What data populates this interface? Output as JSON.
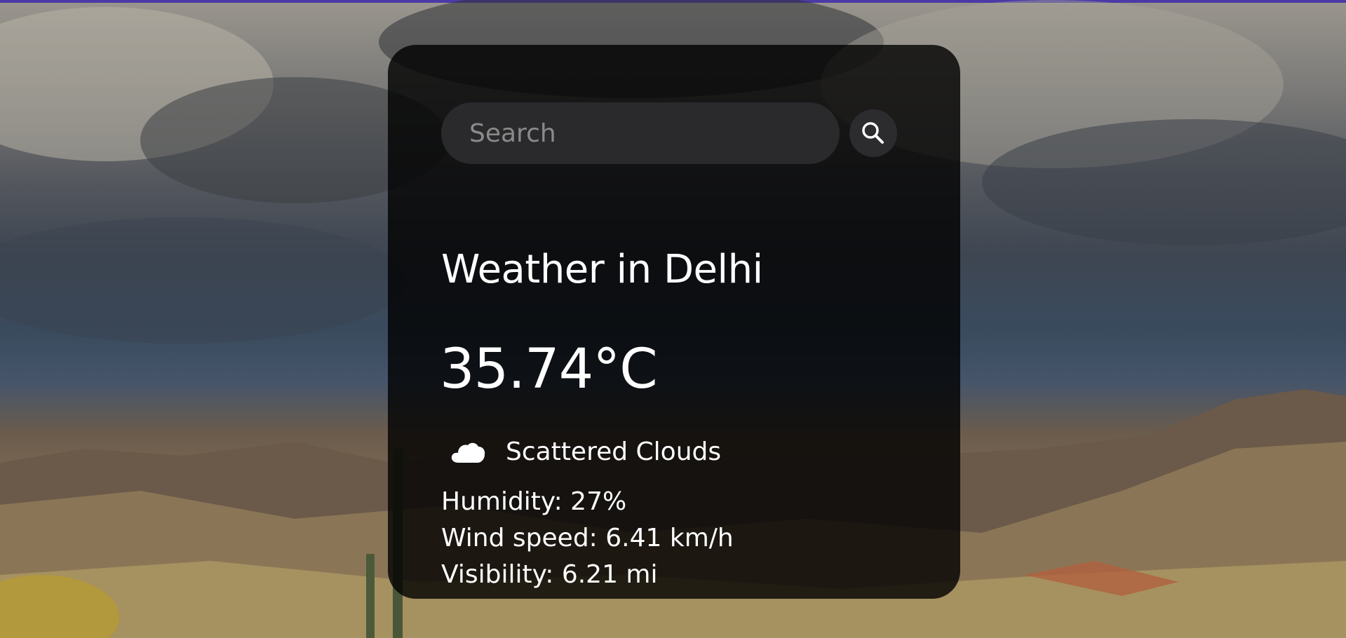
{
  "search": {
    "placeholder": "Search",
    "value": ""
  },
  "weather": {
    "title": "Weather in Delhi",
    "temperature": "35.74°C",
    "description": "Scattered Clouds",
    "humidity": "Humidity: 27%",
    "wind": "Wind speed: 6.41 km/h",
    "visibility": "Visibility: 6.21 mi",
    "icon": "cloud-icon"
  },
  "colors": {
    "card": "#000000",
    "text": "#ffffff",
    "input": "#2a2a2c",
    "accent_top": "#4b3aa6"
  },
  "icons": {
    "search_button": "search-icon"
  }
}
